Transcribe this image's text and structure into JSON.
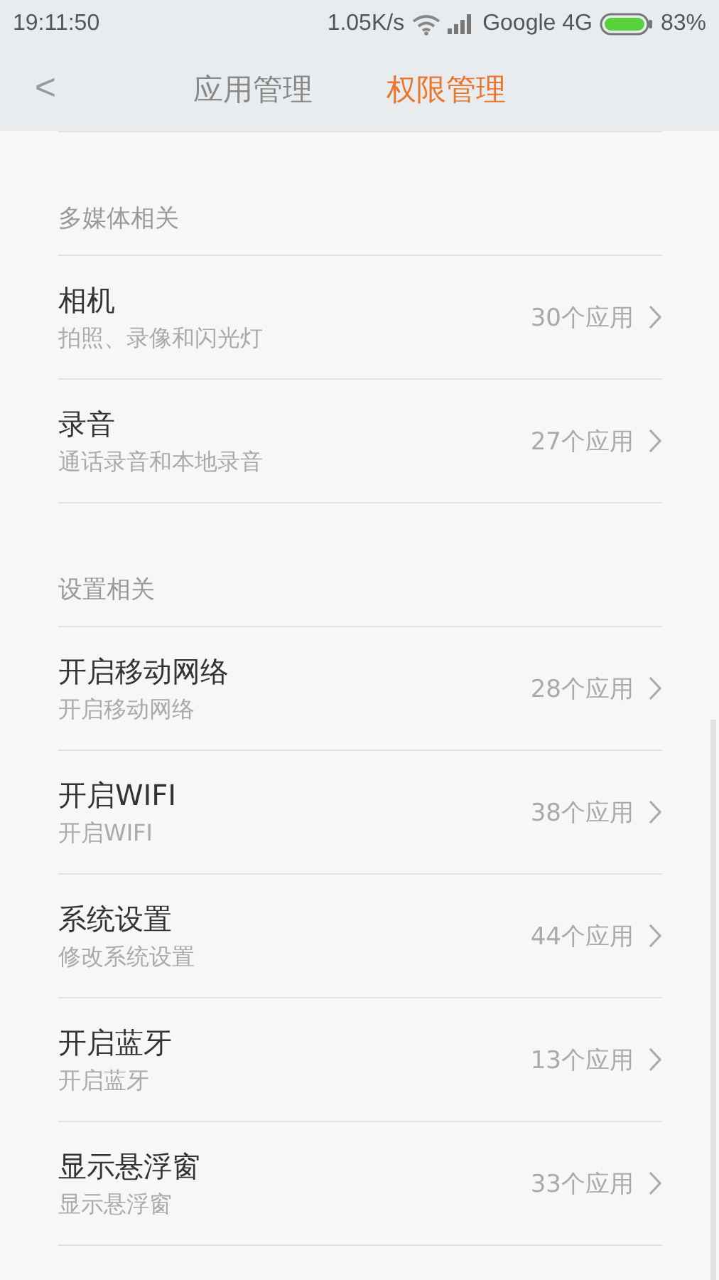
{
  "status_bar": {
    "time": "19:11:50",
    "speed": "1.05K/s",
    "carrier": "Google 4G",
    "battery": "83%"
  },
  "nav": {
    "back": "<",
    "tabs": [
      {
        "label": "应用管理",
        "selected": false
      },
      {
        "label": "权限管理",
        "selected": true
      }
    ]
  },
  "sections": [
    {
      "title": "多媒体相关",
      "items": [
        {
          "name": "相机",
          "description": "拍照、录像和闪光灯",
          "count": "30个应用"
        },
        {
          "name": "录音",
          "description": "通话录音和本地录音",
          "count": "27个应用"
        }
      ]
    },
    {
      "title": "设置相关",
      "items": [
        {
          "name": "开启移动网络",
          "description": "开启移动网络",
          "count": "28个应用"
        },
        {
          "name": "开启WIFI",
          "description": "开启WIFI",
          "count": "38个应用"
        },
        {
          "name": "系统设置",
          "description": "修改系统设置",
          "count": "44个应用"
        },
        {
          "name": "开启蓝牙",
          "description": "开启蓝牙",
          "count": "13个应用"
        },
        {
          "name": "显示悬浮窗",
          "description": "显示悬浮窗",
          "count": "33个应用"
        }
      ]
    }
  ]
}
